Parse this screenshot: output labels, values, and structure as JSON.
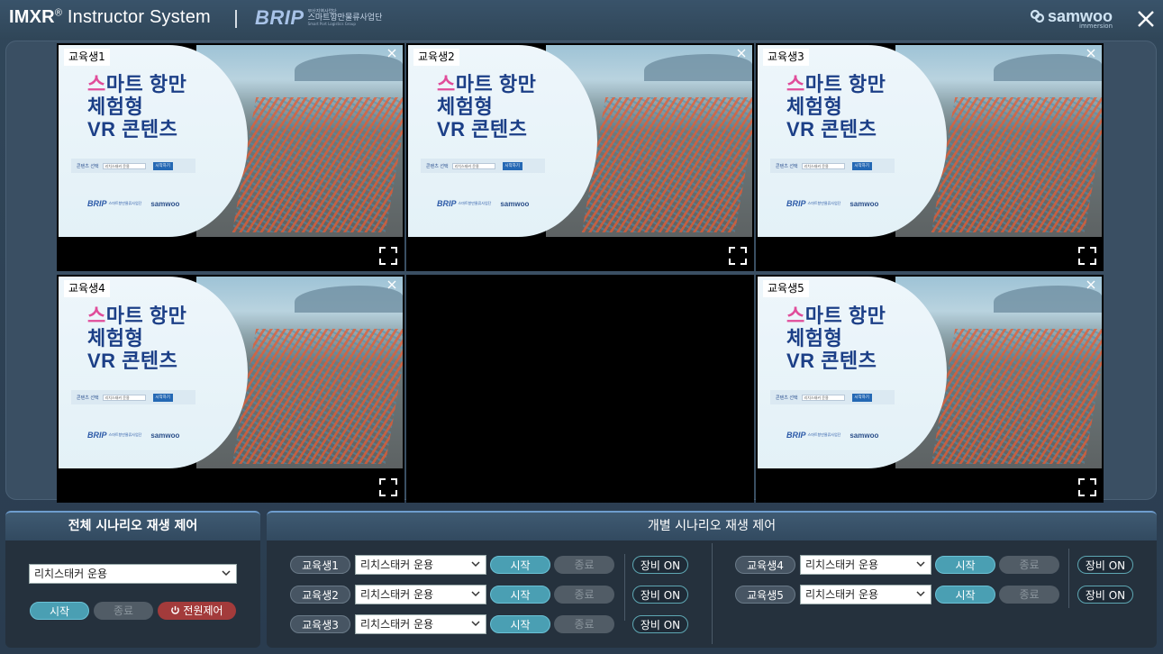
{
  "header": {
    "app_title_brand": "IMXR",
    "app_title_reg": "®",
    "app_title_rest": " Instructor System",
    "partner_logo": "BRIP",
    "partner_sub1": "부산지역사업단",
    "partner_sub2": "스마트항만물류사업단",
    "partner_sub3": "Smart Port Logistics Group",
    "company_logo": "samwoo",
    "company_sub": "immersion",
    "close_icon": "close-icon"
  },
  "monitor": {
    "cells": [
      {
        "label": "교육생1",
        "has_feed": true
      },
      {
        "label": "교육생2",
        "has_feed": true
      },
      {
        "label": "교육생3",
        "has_feed": true
      },
      {
        "label": "교육생4",
        "has_feed": true
      },
      {
        "label": "",
        "has_feed": false
      },
      {
        "label": "교육생5",
        "has_feed": true
      }
    ],
    "feed": {
      "headline_pink": "스",
      "headline_line1_rest": "마트 항만",
      "headline_line2": "체험형",
      "headline_line3": "VR 콘텐츠",
      "content_select_label": "콘텐츠 선택",
      "content_select_value": "리치스태커 운용",
      "start_button": "시작하기",
      "logo_brip": "BRIP",
      "logo_brip_sub": "스마트항만물류사업단",
      "logo_samwoo": "samwoo"
    }
  },
  "global_control": {
    "title": "전체 시나리오 재생 제어",
    "scenario": "리치스태커 운용",
    "start": "시작",
    "stop": "종료",
    "power": "전원제어"
  },
  "individual_control": {
    "title": "개별 시나리오 재생 제어",
    "start": "시작",
    "stop": "종료",
    "equip": "장비 ON",
    "students": [
      {
        "name": "교육생1",
        "scenario": "리치스태커 운용"
      },
      {
        "name": "교육생2",
        "scenario": "리치스태커 운용"
      },
      {
        "name": "교육생3",
        "scenario": "리치스태커 운용"
      },
      {
        "name": "교육생4",
        "scenario": "리치스태커 운용"
      },
      {
        "name": "교육생5",
        "scenario": "리치스태커 운용"
      }
    ]
  }
}
